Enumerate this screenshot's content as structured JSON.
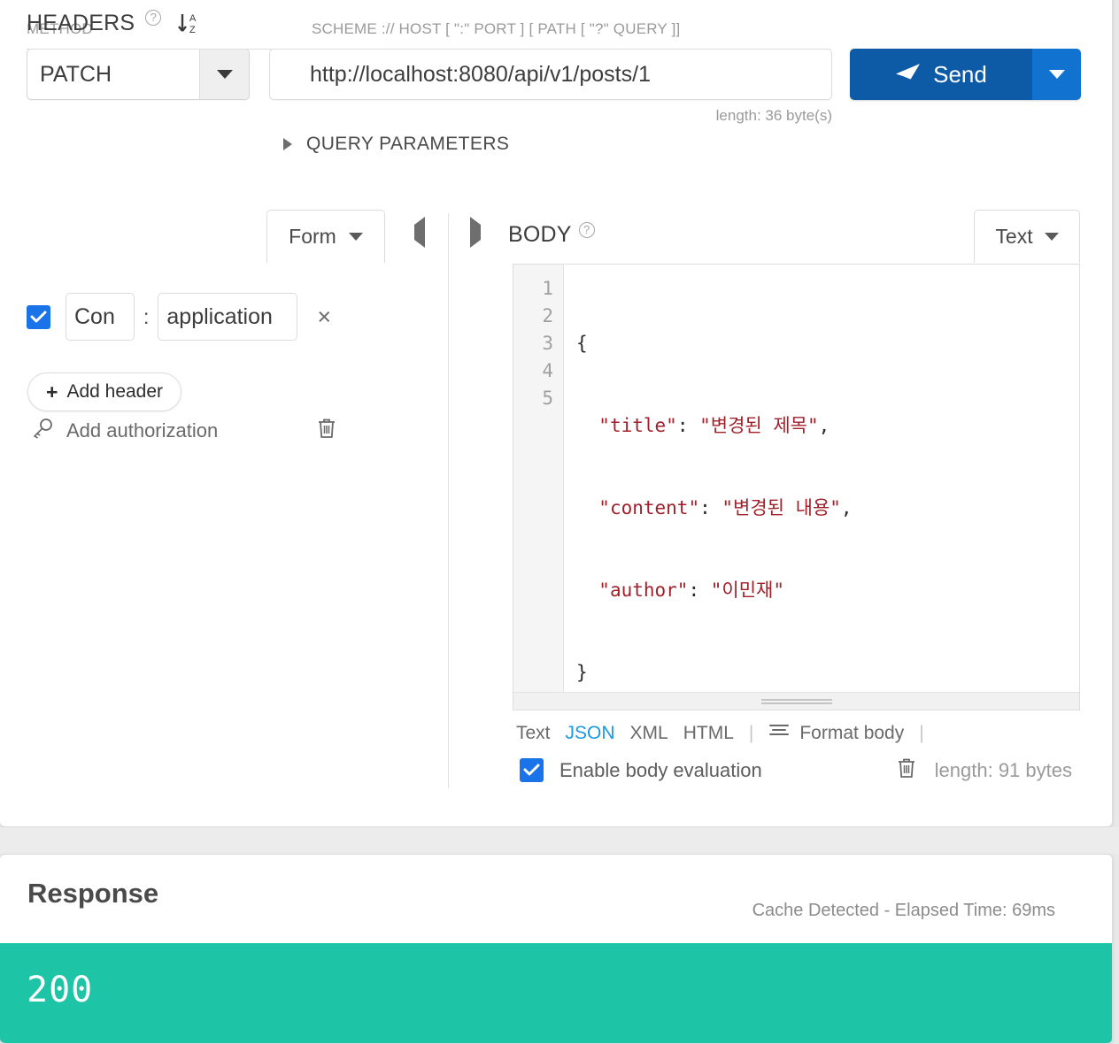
{
  "request": {
    "method_label": "METHOD",
    "method_value": "PATCH",
    "url_label": "SCHEME :// HOST [ \":\" PORT ] [ PATH [ \"?\" QUERY ]]",
    "url_value": "http://localhost:8080/api/v1/posts/1",
    "url_length": "length: 36 byte(s)",
    "send_label": "Send",
    "query_parameters_label": "QUERY PARAMETERS"
  },
  "headers_panel": {
    "title": "HEADERS",
    "help_glyph": "?",
    "sort_top": "A",
    "sort_bottom": "Z",
    "mode_label": "Form",
    "rows": [
      {
        "enabled": true,
        "name": "Con",
        "separator": ":",
        "value": "application",
        "remove_glyph": "×"
      }
    ],
    "add_header_label": "Add header",
    "add_header_plus": "+",
    "add_authorization_label": "Add authorization"
  },
  "body_panel": {
    "title": "BODY",
    "help_glyph": "?",
    "mode_label": "Text",
    "line_numbers": [
      "1",
      "2",
      "3",
      "4",
      "5"
    ],
    "code_lines": [
      {
        "prefix": "{",
        "key": "",
        "mid": "",
        "value": "",
        "suffix": ""
      },
      {
        "prefix": "  ",
        "key": "\"title\"",
        "mid": ": ",
        "value": "\"변경된 제목\"",
        "suffix": ","
      },
      {
        "prefix": "  ",
        "key": "\"content\"",
        "mid": ": ",
        "value": "\"변경된 내용\"",
        "suffix": ","
      },
      {
        "prefix": "  ",
        "key": "\"author\"",
        "mid": ": ",
        "value": "\"이민재\"",
        "suffix": ""
      },
      {
        "prefix": "}",
        "key": "",
        "mid": "",
        "value": "",
        "suffix": ""
      }
    ],
    "format_tabs": [
      "Text",
      "JSON",
      "XML",
      "HTML"
    ],
    "active_format": "JSON",
    "separator_glyph": "|",
    "format_body_label": "Format body",
    "enable_body_evaluation_label": "Enable body evaluation",
    "enable_body_evaluation_checked": true,
    "body_length": "length: 91 bytes"
  },
  "response": {
    "title": "Response",
    "meta": "Cache Detected - Elapsed Time: 69ms",
    "status_code": "200",
    "status_color": "#1ec4a6"
  },
  "colors": {
    "send_primary": "#0d5aa7",
    "send_secondary": "#1272d0",
    "checkbox_blue": "#1a73e8",
    "link_blue": "#1a9ae0",
    "string_red": "#a1212b"
  }
}
